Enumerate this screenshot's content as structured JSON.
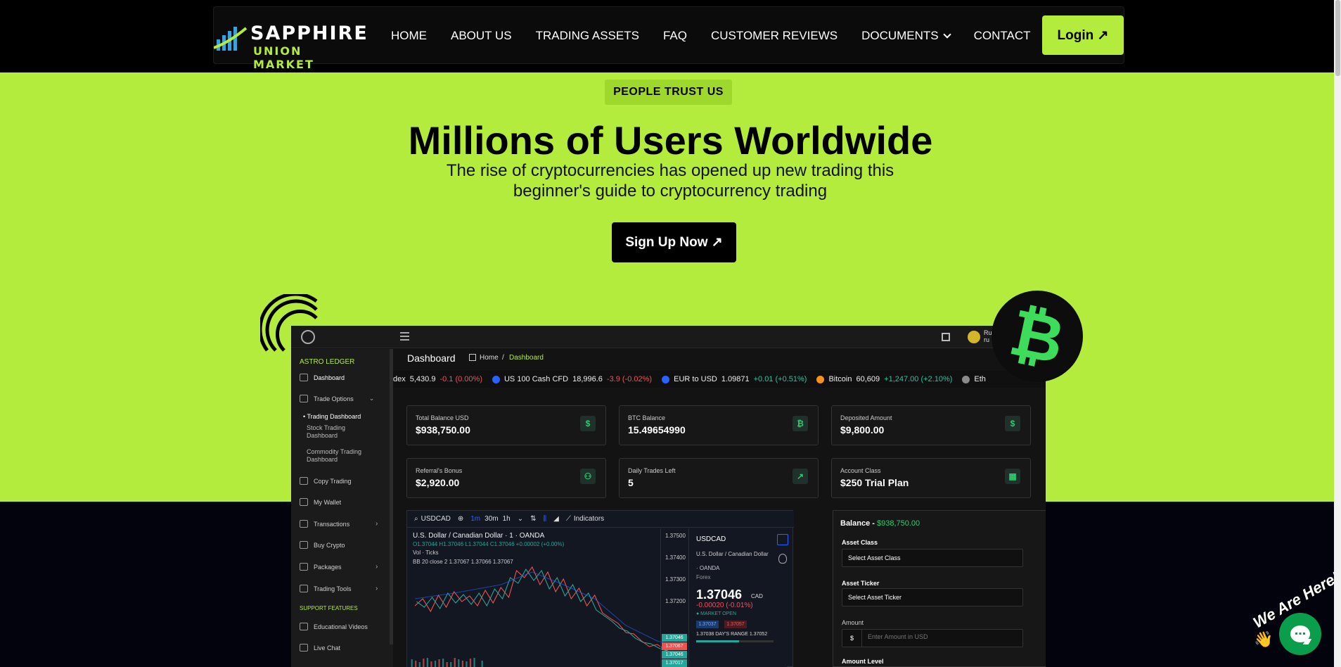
{
  "nav": {
    "logo_line1": "SAPPHIRE",
    "logo_line2": "UNION MARKET",
    "links": [
      "HOME",
      "ABOUT US",
      "TRADING ASSETS",
      "FAQ",
      "CUSTOMER REVIEWS",
      "DOCUMENTS",
      "CONTACT"
    ],
    "login_label": "Login ↗"
  },
  "hero": {
    "badge": "PEOPLE TRUST US",
    "title": "Millions of Users Worldwide",
    "subtitle_line1": "The rise of cryptocurrencies has opened up new trading this",
    "subtitle_line2": "beginner's guide to cryptocurrency trading",
    "signup_label": "Sign Up Now ↗",
    "btc_symbol": "₿"
  },
  "dashboard": {
    "user_name": "Ru",
    "user_sub": "ru",
    "sidebar": {
      "brand": "ASTRO LEDGER",
      "dashboard": "Dashboard",
      "trade_options": "Trade Options",
      "trading_dashboard": "• Trading Dashboard",
      "stock_trading_1": "Stock Trading",
      "stock_trading_2": "Dashboard",
      "commodity_trading_1": "Commodity Trading",
      "commodity_trading_2": "Dashboard",
      "copy_trading": "Copy Trading",
      "my_wallet": "My Wallet",
      "transactions": "Transactions",
      "buy_crypto": "Buy Crypto",
      "packages": "Packages",
      "trading_tools": "Trading Tools",
      "support_features": "SUPPORT FEATURES",
      "educational_videos": "Educational Videos",
      "live_chat": "Live Chat"
    },
    "heading": "Dashboard",
    "breadcrumb_home": "Home",
    "breadcrumb_sep": "/",
    "breadcrumb_current": "Dashboard",
    "ticker": [
      {
        "name": "dex",
        "price": "5,430.9",
        "change": "-0.1 (0.00%)",
        "dir": "neg",
        "color": ""
      },
      {
        "name": "US 100 Cash CFD",
        "price": "18,996.6",
        "change": "-3.9 (-0.02%)",
        "dir": "neg",
        "color": "#2962ff"
      },
      {
        "name": "EUR to USD",
        "price": "1.09871",
        "change": "+0.01 (+0.51%)",
        "dir": "pos",
        "color": "#2962ff"
      },
      {
        "name": "Bitcoin",
        "price": "60,609",
        "change": "+1,247.00 (+2.10%)",
        "dir": "pos",
        "color": "#f7931a"
      },
      {
        "name": "Eth",
        "price": "",
        "change": "",
        "dir": "pos",
        "color": "#8a8a8a"
      }
    ],
    "cards": [
      {
        "label": "Total Balance USD",
        "value": "$938,750.00",
        "icon": "$"
      },
      {
        "label": "BTC Balance",
        "value": "15.49654990",
        "icon": "₿"
      },
      {
        "label": "Deposited Amount",
        "value": "$9,800.00",
        "icon": "$"
      },
      {
        "label": "Referral's Bonus",
        "value": "$2,920.00",
        "icon": "⚇"
      },
      {
        "label": "Daily Trades Left",
        "value": "5",
        "icon": "↗"
      },
      {
        "label": "Account Class",
        "value": "$250 Trial Plan",
        "icon": "▦"
      }
    ],
    "chart": {
      "symbol": "USDCAD",
      "timeframes": [
        "1m",
        "30m",
        "1h"
      ],
      "indicators_label": "Indicators",
      "title": "U.S. Dollar / Canadian Dollar · 1 · OANDA",
      "ohlc": "O1.37044 H1.37046 L1.37044 C1.37046 +0.00002 (+0.00%)",
      "vol": "Vol · Ticks",
      "bb": "BB 20 close 2  1.37067  1.37066  1.37067",
      "yticks": [
        "1.37500",
        "1.37400",
        "1.37300",
        "1.37200"
      ],
      "price_badges": [
        "1.37046",
        "1.37067",
        "1.37046",
        "1.37017"
      ]
    },
    "quote": {
      "symbol": "USDCAD",
      "name": "U.S. Dollar / Canadian Dollar",
      "exchange": "· OANDA",
      "type": "Forex",
      "price": "1.37046",
      "currency": "CAD",
      "change": "-0.00020 (-0.01%)",
      "market": "● MARKET OPEN",
      "bid": "1.37037",
      "ask": "1.37057",
      "range": "1.37038  DAY'S RANGE  1.37052"
    },
    "trade_form": {
      "balance_label": "Balance -",
      "balance_value": "$938,750.00",
      "asset_class_label": "Asset Class",
      "asset_class_value": "Select Asset Class",
      "asset_ticker_label": "Asset Ticker",
      "asset_ticker_value": "Select Asset Ticker",
      "amount_label": "Amount",
      "currency": "$",
      "amount_placeholder": "Enter Amount in USD",
      "amount_level_label": "Amount Level"
    }
  },
  "chat": {
    "label": "We Are Here!",
    "wave": "👋"
  }
}
